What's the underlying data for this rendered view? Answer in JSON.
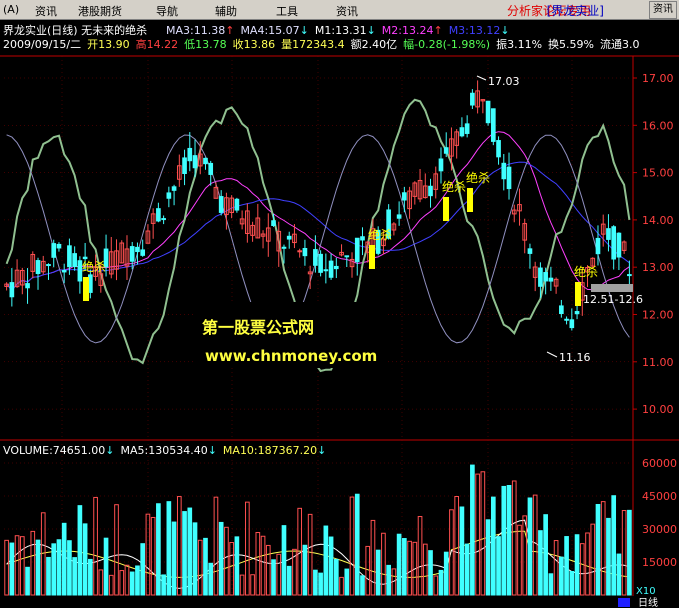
{
  "menu": [
    "(A)",
    "资讯",
    "港股期货",
    "导航",
    "辅助",
    "工具",
    "资讯"
  ],
  "banner_text": "分析家论坛专用",
  "banner_stock": "[界龙实业]",
  "stock": {
    "title": "界龙实业(日线) 无未来的绝杀",
    "ma_items": [
      {
        "label": "MA3:11.38",
        "color": "#e0e0ff",
        "arrow": "↑"
      },
      {
        "label": "MA4:15.07",
        "color": "#e0e0ff",
        "arrow": "↓"
      },
      {
        "label": "M1:13.31",
        "color": "#ffffff",
        "arrow": "↓"
      },
      {
        "label": "M2:13.24",
        "color": "#ff40ff",
        "arrow": "↑"
      },
      {
        "label": "M3:13.12",
        "color": "#4040ff",
        "arrow": "↓"
      }
    ]
  },
  "ohlc_line": [
    {
      "text": "2009/09/15/二",
      "color": "#ffffff"
    },
    {
      "text": "开13.90",
      "color": "#ffff55"
    },
    {
      "text": "高14.22",
      "color": "#ff4040"
    },
    {
      "text": "低13.78",
      "color": "#55ff55"
    },
    {
      "text": "收13.86",
      "color": "#ffff55"
    },
    {
      "text": "量172343.4",
      "color": "#ffff55"
    },
    {
      "text": "额2.40亿",
      "color": "#ffffff"
    },
    {
      "text": "幅-0.28(-1.98%)",
      "color": "#55ff55"
    },
    {
      "text": "振3.11%",
      "color": "#ffffff"
    },
    {
      "text": "换5.59%",
      "color": "#ffffff"
    },
    {
      "text": "流通3.0",
      "color": "#ffffff"
    }
  ],
  "price_axis": [
    "17.00",
    "16.00",
    "15.00",
    "14.00",
    "13.00",
    "12.00",
    "11.00",
    "10.00"
  ],
  "annotations": {
    "high": "17.03",
    "low": "11.16",
    "range": "12.51-12.6",
    "signal": "绝杀",
    "watermark_title": "第一股票公式网",
    "watermark_url": "www.chnmoney.com"
  },
  "volume_header": [
    {
      "text": "VOLUME:74651.00",
      "color": "#ffffff",
      "arrow": "↓"
    },
    {
      "text": "MA5:130534.40",
      "color": "#ffffff",
      "arrow": "↓"
    },
    {
      "text": "MA10:187367.20",
      "color": "#ffff55",
      "arrow": "↓"
    }
  ],
  "volume_axis": [
    "60000",
    "45000",
    "30000",
    "15000"
  ],
  "volume_unit": "X10",
  "bottom_label": "日线",
  "colors": {
    "up": "#ff5050",
    "down": "#40ffff",
    "grid": "#800000",
    "axis": "#c00000"
  }
}
